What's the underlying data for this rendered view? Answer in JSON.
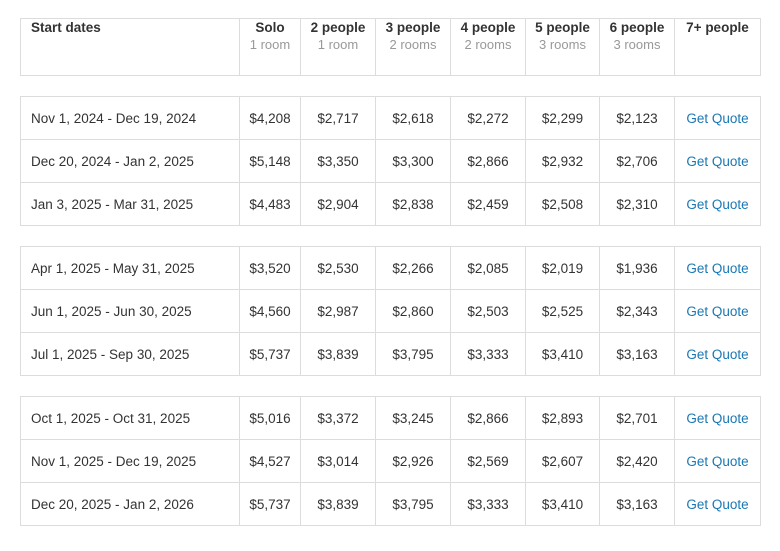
{
  "header": {
    "date_label": "Start dates",
    "columns": [
      {
        "title": "Solo",
        "sub": "1 room"
      },
      {
        "title": "2 people",
        "sub": "1 room"
      },
      {
        "title": "3 people",
        "sub": "2 rooms"
      },
      {
        "title": "4 people",
        "sub": "2 rooms"
      },
      {
        "title": "5 people",
        "sub": "3 rooms"
      },
      {
        "title": "6 people",
        "sub": "3 rooms"
      },
      {
        "title": "7+ people",
        "sub": ""
      }
    ]
  },
  "quote_label": "Get Quote",
  "colors": {
    "link": "#1a78b4",
    "border": "#dcdcdc",
    "muted": "#999999",
    "text": "#333333"
  },
  "groups": [
    {
      "rows": [
        {
          "dates": "Nov 1, 2024 - Dec 19, 2024",
          "prices": [
            "$4,208",
            "$2,717",
            "$2,618",
            "$2,272",
            "$2,299",
            "$2,123"
          ]
        },
        {
          "dates": "Dec 20, 2024 - Jan 2, 2025",
          "prices": [
            "$5,148",
            "$3,350",
            "$3,300",
            "$2,866",
            "$2,932",
            "$2,706"
          ]
        },
        {
          "dates": "Jan 3, 2025 - Mar 31, 2025",
          "prices": [
            "$4,483",
            "$2,904",
            "$2,838",
            "$2,459",
            "$2,508",
            "$2,310"
          ]
        }
      ]
    },
    {
      "rows": [
        {
          "dates": "Apr 1, 2025 - May 31, 2025",
          "prices": [
            "$3,520",
            "$2,530",
            "$2,266",
            "$2,085",
            "$2,019",
            "$1,936"
          ]
        },
        {
          "dates": "Jun 1, 2025 - Jun 30, 2025",
          "prices": [
            "$4,560",
            "$2,987",
            "$2,860",
            "$2,503",
            "$2,525",
            "$2,343"
          ]
        },
        {
          "dates": "Jul 1, 2025 - Sep 30, 2025",
          "prices": [
            "$5,737",
            "$3,839",
            "$3,795",
            "$3,333",
            "$3,410",
            "$3,163"
          ]
        }
      ]
    },
    {
      "rows": [
        {
          "dates": "Oct 1, 2025 - Oct 31, 2025",
          "prices": [
            "$5,016",
            "$3,372",
            "$3,245",
            "$2,866",
            "$2,893",
            "$2,701"
          ]
        },
        {
          "dates": "Nov 1, 2025 - Dec 19, 2025",
          "prices": [
            "$4,527",
            "$3,014",
            "$2,926",
            "$2,569",
            "$2,607",
            "$2,420"
          ]
        },
        {
          "dates": "Dec 20, 2025 - Jan 2, 2026",
          "prices": [
            "$5,737",
            "$3,839",
            "$3,795",
            "$3,333",
            "$3,410",
            "$3,163"
          ]
        }
      ]
    }
  ]
}
